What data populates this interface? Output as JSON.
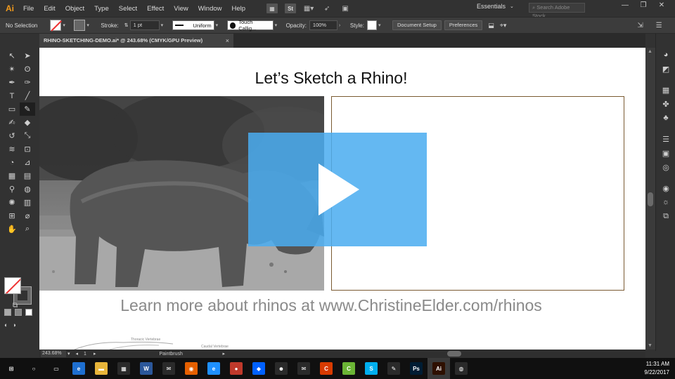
{
  "app": {
    "logo": "Ai",
    "menus": [
      "File",
      "Edit",
      "Object",
      "Type",
      "Select",
      "Effect",
      "View",
      "Window",
      "Help"
    ],
    "workspace": "Essentials",
    "stock_search_placeholder": "Search Adobe Stock",
    "stock_icon": "St"
  },
  "control_bar": {
    "selection": "No Selection",
    "stroke_label": "Stroke:",
    "stroke_value": "1 pt",
    "stroke_profile": "Uniform",
    "brush": "Touch Callig...",
    "opacity_label": "Opacity:",
    "opacity_value": "100%",
    "style_label": "Style:",
    "document_setup": "Document Setup",
    "preferences": "Preferences"
  },
  "document": {
    "tab_title": "RHINO-SKETCHING-DEMO.ai* @ 243.68% (CMYK/GPU Preview)",
    "tab_close": "×"
  },
  "artboard": {
    "title": "Let’s Sketch a Rhino!",
    "learn_more": "Learn more about rhinos at www.ChristineElder.com/rhinos",
    "anatomy_labels": [
      "Thoracic Vertebrae",
      "Caudal Vertebrae"
    ]
  },
  "status": {
    "zoom": "243.68%",
    "artboard_number": "1",
    "current_tool": "Paintbrush"
  },
  "taskbar": {
    "time": "11:31 AM",
    "date": "9/22/2017",
    "apps": [
      {
        "name": "start",
        "glyph": "⊞",
        "color": "#101010"
      },
      {
        "name": "cortana",
        "glyph": "○",
        "color": "#101010"
      },
      {
        "name": "task-view",
        "glyph": "▭",
        "color": "#101010"
      },
      {
        "name": "edge",
        "glyph": "e",
        "color": "#1e6fd0"
      },
      {
        "name": "file-explorer",
        "glyph": "▬",
        "color": "#e8b53a"
      },
      {
        "name": "store",
        "glyph": "▦",
        "color": "#2a2a2a"
      },
      {
        "name": "word",
        "glyph": "W",
        "color": "#2b579a"
      },
      {
        "name": "outlook",
        "glyph": "✉",
        "color": "#2a2a2a"
      },
      {
        "name": "firefox",
        "glyph": "◉",
        "color": "#e66000"
      },
      {
        "name": "internet-explorer",
        "glyph": "e",
        "color": "#1e90ff"
      },
      {
        "name": "screen-recorder",
        "glyph": "●",
        "color": "#c0392b"
      },
      {
        "name": "dropbox",
        "glyph": "◆",
        "color": "#0061ff"
      },
      {
        "name": "owl-app",
        "glyph": "☻",
        "color": "#2a2a2a"
      },
      {
        "name": "mail",
        "glyph": "✉",
        "color": "#2a2a2a"
      },
      {
        "name": "office",
        "glyph": "C",
        "color": "#d83b01"
      },
      {
        "name": "camtasia",
        "glyph": "C",
        "color": "#6bb535"
      },
      {
        "name": "skype",
        "glyph": "S",
        "color": "#00aff0"
      },
      {
        "name": "pen-app",
        "glyph": "✎",
        "color": "#2a2a2a"
      },
      {
        "name": "photoshop",
        "glyph": "Ps",
        "color": "#001d34"
      },
      {
        "name": "illustrator",
        "glyph": "Ai",
        "color": "#2e1000"
      },
      {
        "name": "chrome",
        "glyph": "◍",
        "color": "#2a2a2a"
      }
    ]
  },
  "colors": {
    "play_overlay": "#4aacf0",
    "sketch_border": "#7a5a32",
    "ai_orange": "#f29b1d"
  }
}
